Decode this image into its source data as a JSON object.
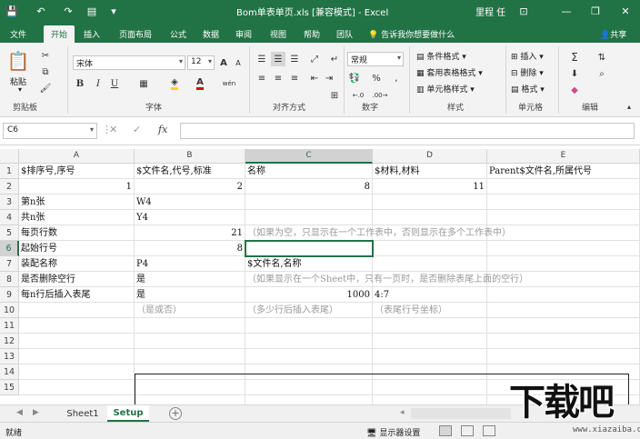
{
  "window": {
    "title": "Bom单表单页.xls [兼容模式] - Excel",
    "user": "里程 任",
    "minimize": "—",
    "restore": "❐",
    "close": "✕",
    "ribbon_options": "⊡"
  },
  "ribbon": {
    "tabs": [
      "文件",
      "开始",
      "插入",
      "页面布局",
      "公式",
      "数据",
      "审阅",
      "视图",
      "帮助",
      "团队"
    ],
    "active_tab": "开始",
    "tell_me": "告诉我你想要做什么",
    "share": "共享",
    "clipboard": {
      "paste": "粘贴",
      "label": "剪贴板"
    },
    "font": {
      "name": "宋体",
      "size": "12",
      "bold": "B",
      "italic": "I",
      "underline": "U",
      "grow": "A",
      "shrink": "A",
      "label": "字体",
      "phonetic": "wén"
    },
    "alignment": {
      "label": "对齐方式"
    },
    "number": {
      "format": "常规",
      "percent": "%",
      "comma": ",",
      "label": "数字"
    },
    "styles": {
      "conditional": "条件格式",
      "table": "套用表格格式",
      "cell": "单元格样式",
      "label": "样式"
    },
    "cells": {
      "insert": "插入",
      "delete": "删除",
      "format": "格式",
      "label": "单元格"
    },
    "editing": {
      "sum": "Σ",
      "label": "编辑"
    },
    "accent_color": "#217346"
  },
  "formula_bar": {
    "name_box": "C6",
    "cancel": "✕",
    "enter": "✓",
    "fx": "fx",
    "content": ""
  },
  "columns": [
    "A",
    "B",
    "C",
    "D",
    "E"
  ],
  "selected_column": "C",
  "rows": [
    "1",
    "2",
    "3",
    "4",
    "5",
    "6",
    "7",
    "8",
    "9",
    "10",
    "11",
    "12",
    "13",
    "14",
    "15"
  ],
  "selected_row": "6",
  "cells": {
    "r1": {
      "a": "$排序号,序号",
      "b": "$文件名,代号,标准",
      "c": "名称",
      "d": "$材料,材料",
      "e": "Parent$文件名,所属代号"
    },
    "r2": {
      "a": "1",
      "b": "2",
      "c": "8",
      "d": "11"
    },
    "r3": {
      "a": "第n张",
      "b": "W4"
    },
    "r4": {
      "a": "共n张",
      "b": "Y4"
    },
    "r5": {
      "a": "每页行数",
      "b": "21",
      "c": "（如果为空，只显示在一个工作表中，否则显示在多个工作表中）"
    },
    "r6": {
      "a": "起始行号",
      "b": "8"
    },
    "r7": {
      "a": "装配名称",
      "b": "P4",
      "c": "$文件名,名称"
    },
    "r8": {
      "a": "是否删除空行",
      "b": "是",
      "c": "（如果显示在一个Sheet中，只有一页时，是否删除表尾上面的空行）"
    },
    "r9": {
      "a": "每n行后插入表尾",
      "b": "是",
      "c": "1000",
      "d": "4:7"
    },
    "r10": {
      "b": "（是或否）",
      "c": "（多少行后插入表尾）",
      "d": "（表尾行号坐标）"
    }
  },
  "sheets": {
    "tabs": [
      "Sheet1",
      "Setup"
    ],
    "active": "Setup",
    "add": "+"
  },
  "status": {
    "ready": "就绪",
    "display_settings": "显示器设置"
  },
  "watermark": {
    "text": "下载吧",
    "url": "www.xiazaiba.com"
  }
}
